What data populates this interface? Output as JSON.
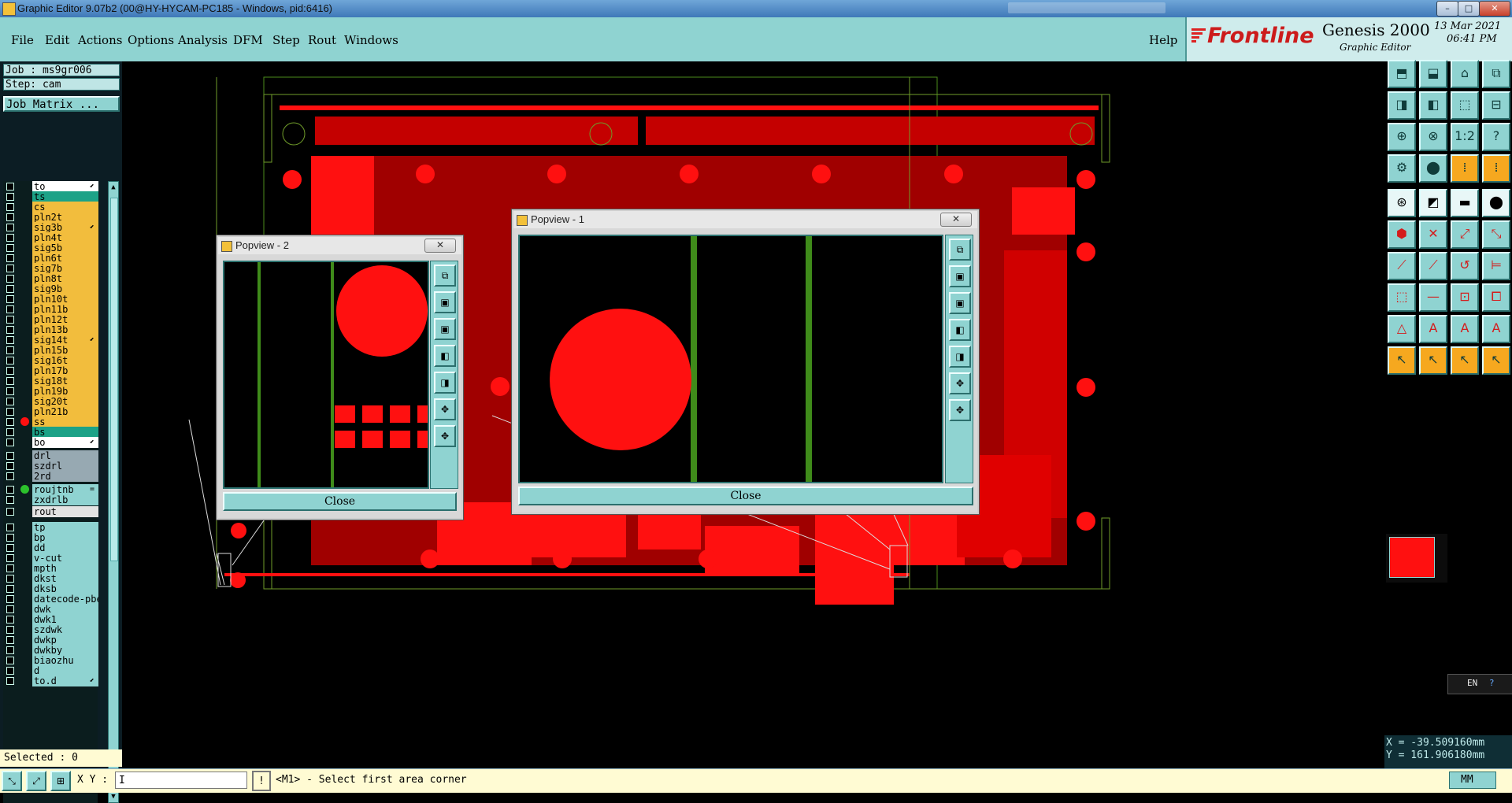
{
  "window": {
    "title": "Graphic Editor 9.07b2 (00@HY-HYCAM-PC185 - Windows, pid:6416)",
    "minimize": "–",
    "maximize": "□",
    "close": "✕"
  },
  "menubar": {
    "items": [
      {
        "label": "File",
        "icon": "none"
      },
      {
        "label": "Edit"
      },
      {
        "label": "Actions"
      },
      {
        "label": "Options"
      },
      {
        "label": "Analysis"
      },
      {
        "label": "DFM"
      },
      {
        "label": "Step"
      },
      {
        "label": "Rout"
      },
      {
        "label": "Windows"
      }
    ],
    "help": "Help"
  },
  "brand": {
    "logo": "Frontline",
    "product": "Genesis 2000",
    "subtitle": "Graphic Editor",
    "date": "13 Mar 2021",
    "time": "06:41 PM"
  },
  "left": {
    "job": "Job : ms9gr006",
    "step": "Step: cam",
    "job_matrix": "Job Matrix ...",
    "selected": "Selected : 0"
  },
  "layers": [
    {
      "name": "to",
      "color": "#ffffff",
      "marker": "⬋"
    },
    {
      "name": "ts",
      "color": "#1ca287"
    },
    {
      "name": "cs",
      "color": "#f2bd3d"
    },
    {
      "name": "pln2t",
      "color": "#f2bd3d"
    },
    {
      "name": "sig3b",
      "color": "#f2bd3d",
      "marker": "⬋"
    },
    {
      "name": "pln4t",
      "color": "#f2bd3d"
    },
    {
      "name": "sig5b",
      "color": "#f2bd3d"
    },
    {
      "name": "pln6t",
      "color": "#f2bd3d"
    },
    {
      "name": "sig7b",
      "color": "#f2bd3d"
    },
    {
      "name": "pln8t",
      "color": "#f2bd3d"
    },
    {
      "name": "sig9b",
      "color": "#f2bd3d"
    },
    {
      "name": "pln10t",
      "color": "#f2bd3d"
    },
    {
      "name": "pln11b",
      "color": "#f2bd3d"
    },
    {
      "name": "pln12t",
      "color": "#f2bd3d"
    },
    {
      "name": "pln13b",
      "color": "#f2bd3d"
    },
    {
      "name": "sig14t",
      "color": "#f2bd3d",
      "marker": "⬋"
    },
    {
      "name": "pln15b",
      "color": "#f2bd3d"
    },
    {
      "name": "sig16t",
      "color": "#f2bd3d"
    },
    {
      "name": "pln17b",
      "color": "#f2bd3d"
    },
    {
      "name": "sig18t",
      "color": "#f2bd3d"
    },
    {
      "name": "pln19b",
      "color": "#f2bd3d"
    },
    {
      "name": "sig20t",
      "color": "#f2bd3d"
    },
    {
      "name": "pln21b",
      "color": "#f2bd3d"
    },
    {
      "name": "ss",
      "color": "#f2bd3d",
      "dot": "#ff1010"
    },
    {
      "name": "bs",
      "color": "#1ca287"
    },
    {
      "name": "bo",
      "color": "#ffffff",
      "marker": "⬋"
    },
    {
      "name": "drl",
      "color": "#97a9b2"
    },
    {
      "name": "szdrl",
      "color": "#97a9b2"
    },
    {
      "name": "2rd",
      "color": "#97a9b2"
    },
    {
      "name": "roujtnb",
      "color": "#8fd3d1",
      "dot": "#2cc12c",
      "marker": "="
    },
    {
      "name": "zxdrlb",
      "color": "#8fd3d1"
    },
    {
      "name": "rout",
      "color": "#e3e3e3"
    },
    {
      "name": "tp",
      "color": "#8fd3d1"
    },
    {
      "name": "bp",
      "color": "#8fd3d1"
    },
    {
      "name": "dd",
      "color": "#8fd3d1"
    },
    {
      "name": "v-cut",
      "color": "#8fd3d1"
    },
    {
      "name": "mpth",
      "color": "#8fd3d1"
    },
    {
      "name": "dkst",
      "color": "#8fd3d1"
    },
    {
      "name": "dksb",
      "color": "#8fd3d1"
    },
    {
      "name": "datecode-pbe",
      "color": "#8fd3d1"
    },
    {
      "name": "dwk",
      "color": "#8fd3d1"
    },
    {
      "name": "dwk1",
      "color": "#8fd3d1"
    },
    {
      "name": "szdwk",
      "color": "#8fd3d1"
    },
    {
      "name": "dwkp",
      "color": "#8fd3d1"
    },
    {
      "name": "dwkby",
      "color": "#8fd3d1"
    },
    {
      "name": "biaozhu",
      "color": "#8fd3d1"
    },
    {
      "name": "d",
      "color": "#8fd3d1"
    },
    {
      "name": "to.d",
      "color": "#8fd3d1",
      "marker": "⬋"
    }
  ],
  "popview2": {
    "title": "Popview - 2",
    "close": "Close",
    "x_btn": "✕"
  },
  "popview1": {
    "title": "Popview - 1",
    "close": "Close",
    "x_btn": "✕"
  },
  "status": {
    "xy_label": "X Y :",
    "xy_value": "I",
    "prompt": "<M1> - Select first area corner",
    "units": "MM",
    "ime": "EN"
  },
  "coordinates": {
    "x": "X = -39.509160mm",
    "y": "Y =  161.906180mm"
  },
  "colors": {
    "panel": "#8fd3d1",
    "copper": "#ff0000",
    "outline": "#6f9b2a",
    "highlight": "#f6a81f"
  }
}
